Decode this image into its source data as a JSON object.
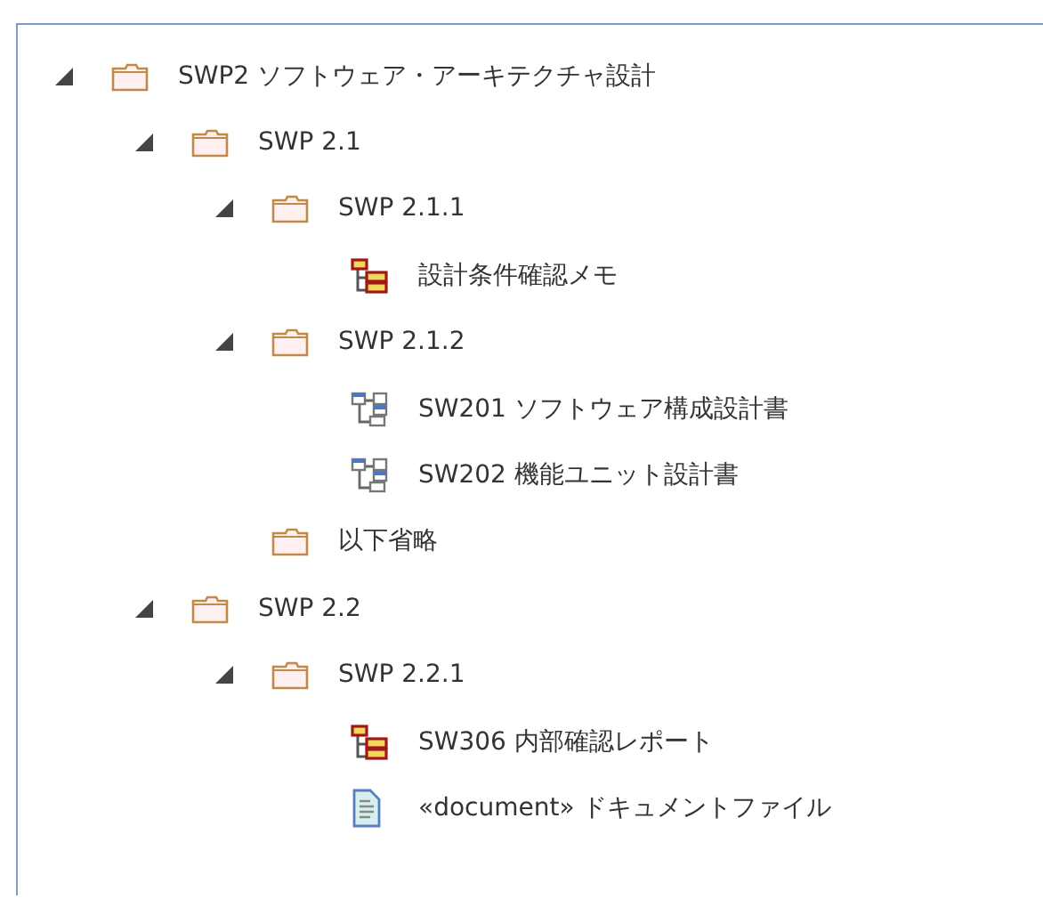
{
  "tree": [
    {
      "kind": "folder",
      "label": "SWP2 ソフトウェア・アーキテクチャ設計",
      "expanded": true,
      "children": [
        {
          "kind": "folder",
          "label": "SWP 2.1",
          "expanded": true,
          "children": [
            {
              "kind": "folder",
              "label": "SWP 2.1.1",
              "expanded": true,
              "children": [
                {
                  "kind": "red-diagram",
                  "label": "設計条件確認メモ"
                }
              ]
            },
            {
              "kind": "folder",
              "label": "SWP 2.1.2",
              "expanded": true,
              "children": [
                {
                  "kind": "blue-diagram",
                  "label": "SW201 ソフトウェア構成設計書"
                },
                {
                  "kind": "blue-diagram",
                  "label": "SW202 機能ユニット設計書"
                }
              ]
            },
            {
              "kind": "folder",
              "label": "以下省略"
            }
          ]
        },
        {
          "kind": "folder",
          "label": "SWP 2.2",
          "expanded": true,
          "children": [
            {
              "kind": "folder",
              "label": "SWP 2.2.1",
              "expanded": true,
              "children": [
                {
                  "kind": "red-diagram",
                  "label": "SW306 内部確認レポート"
                },
                {
                  "kind": "document",
                  "label": "«document» ドキュメントファイル"
                }
              ]
            }
          ]
        }
      ]
    }
  ]
}
